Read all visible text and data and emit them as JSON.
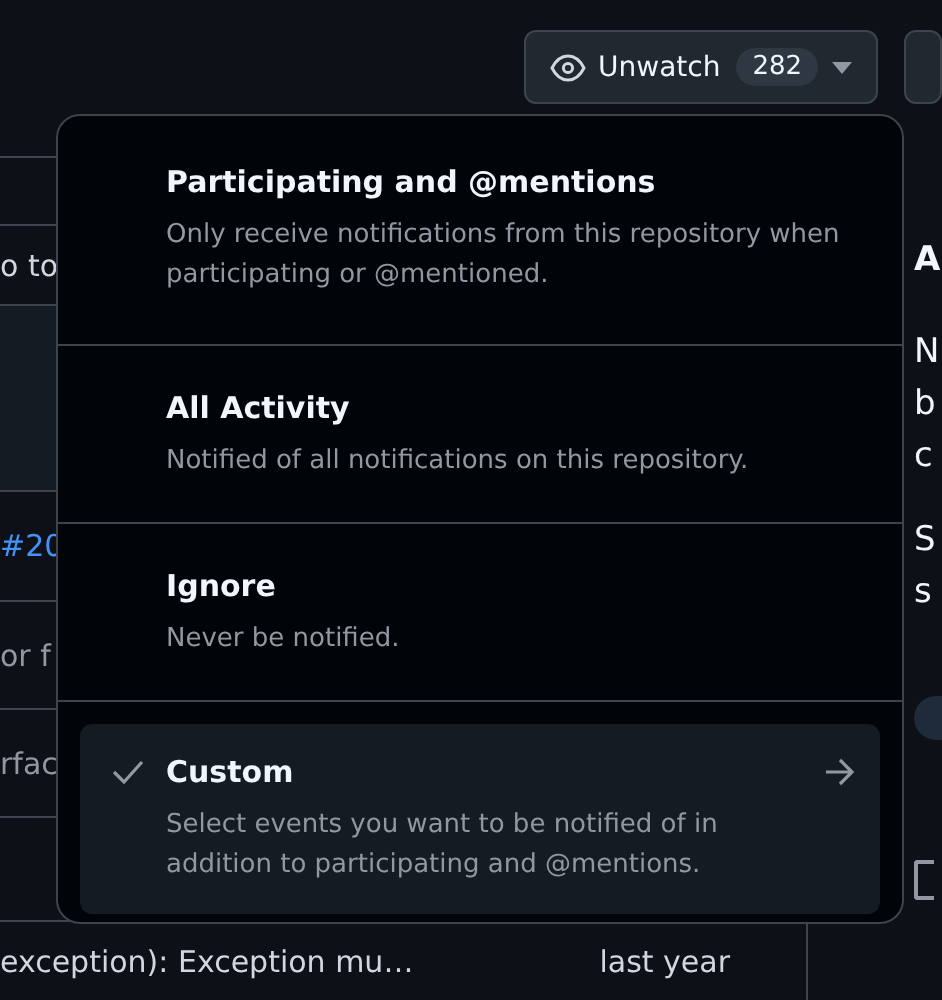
{
  "top_bar": {
    "watch_button": {
      "label": "Unwatch",
      "count": "282"
    }
  },
  "list": {
    "rows": [
      {
        "text": "o to",
        "kind": "plain"
      },
      {
        "text": "#20",
        "kind": "link"
      },
      {
        "text": "or f",
        "kind": "plain"
      },
      {
        "text": "rfac",
        "kind": "plain"
      },
      {
        "text": "exception): Exception mu…",
        "kind": "plain",
        "time": "last year"
      }
    ]
  },
  "sidebar": {
    "heading": "A",
    "lines": [
      "N",
      "b",
      "c",
      "S",
      "s"
    ]
  },
  "menu": {
    "items": [
      {
        "title": "Participating and @mentions",
        "description": "Only receive notifications from this repository when participating or @mentioned.",
        "selected": false,
        "has_submenu": false
      },
      {
        "title": "All Activity",
        "description": "Notified of all notifications on this repository.",
        "selected": false,
        "has_submenu": false
      },
      {
        "title": "Ignore",
        "description": "Never be notified.",
        "selected": false,
        "has_submenu": false
      },
      {
        "title": "Custom",
        "description": "Select events you want to be notified of in addition to participating and @mentions.",
        "selected": true,
        "has_submenu": true
      }
    ]
  }
}
